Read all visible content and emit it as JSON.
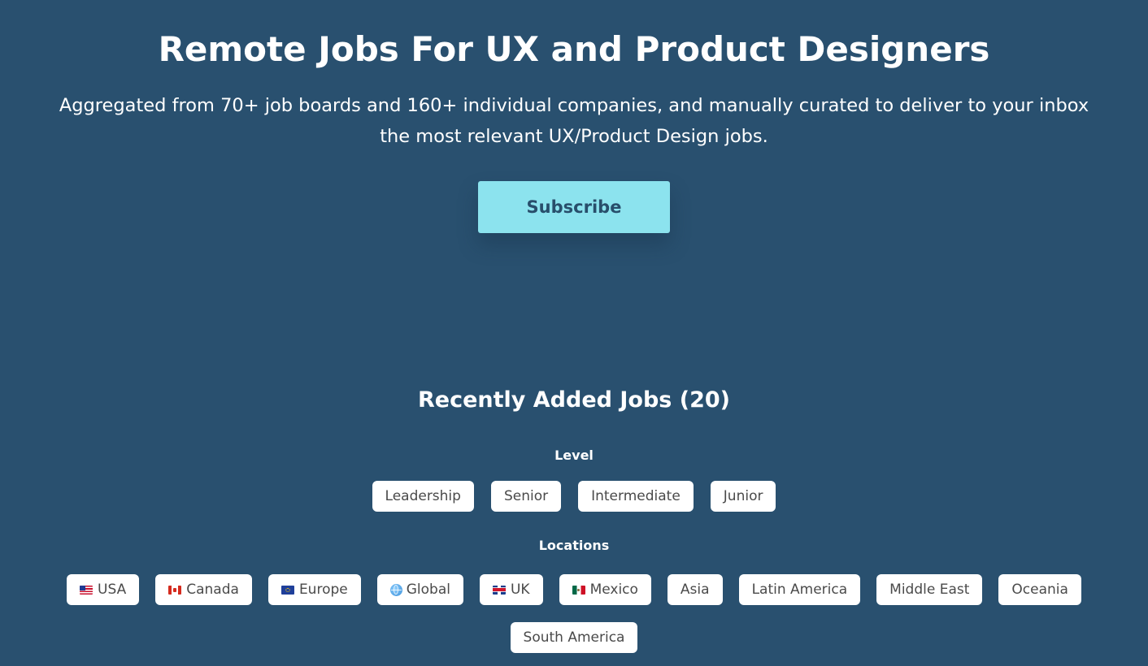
{
  "hero": {
    "title": "Remote Jobs For UX and Product Designers",
    "subtitle_line1": "Aggregated from 70+ job boards and 160+ individual companies, and manually curated to deliver to your inbox",
    "subtitle_line2": "the most relevant UX/Product Design jobs.",
    "subscribe_label": "Subscribe"
  },
  "jobs": {
    "title": "Recently Added Jobs (20)"
  },
  "filters": {
    "level": {
      "label": "Level",
      "options": [
        "Leadership",
        "Senior",
        "Intermediate",
        "Junior"
      ]
    },
    "locations": {
      "label": "Locations",
      "options": [
        {
          "label": "USA",
          "icon": "usa-flag-icon"
        },
        {
          "label": "Canada",
          "icon": "canada-flag-icon"
        },
        {
          "label": "Europe",
          "icon": "europe-flag-icon"
        },
        {
          "label": "Global",
          "icon": "globe-icon"
        },
        {
          "label": "UK",
          "icon": "uk-flag-icon"
        },
        {
          "label": "Mexico",
          "icon": "mexico-flag-icon"
        },
        {
          "label": "Asia"
        },
        {
          "label": "Latin America"
        },
        {
          "label": "Middle East"
        },
        {
          "label": "Oceania"
        },
        {
          "label": "South America"
        }
      ]
    }
  },
  "colors": {
    "background": "#29506f",
    "subscribe_bg": "#8ce3ee",
    "subscribe_text": "#284e6b",
    "chip_bg": "#ffffff",
    "chip_text": "#4a4a4a"
  }
}
